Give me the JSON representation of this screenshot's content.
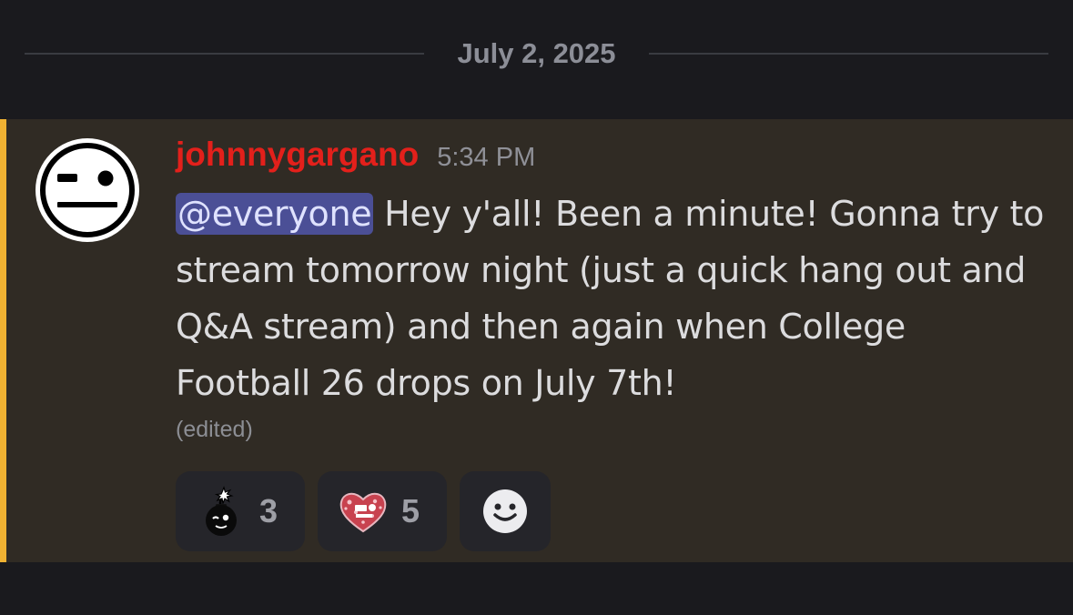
{
  "date_divider": {
    "label": "July 2, 2025"
  },
  "message": {
    "author": "johnnygargano",
    "timestamp": "5:34 PM",
    "mention": "@everyone",
    "body": " Hey y'all! Been a minute! Gonna try to stream tomorrow night (just a quick hang out and Q&A stream) and then again when College Football 26 drops on July 7th!",
    "edited_label": "(edited)",
    "avatar_icon": "neutral-face-avatar-icon",
    "colors": {
      "author": "#e3201b",
      "accent": "#f0b232",
      "mention_bg": "#4b4f96",
      "highlight_bg": "#302b24"
    }
  },
  "reactions": [
    {
      "icon": "bomb-emoji-icon",
      "count": "3"
    },
    {
      "icon": "sparkly-heart-emoji-icon",
      "count": "5"
    },
    {
      "icon": "add-reaction-smiley-icon"
    }
  ]
}
